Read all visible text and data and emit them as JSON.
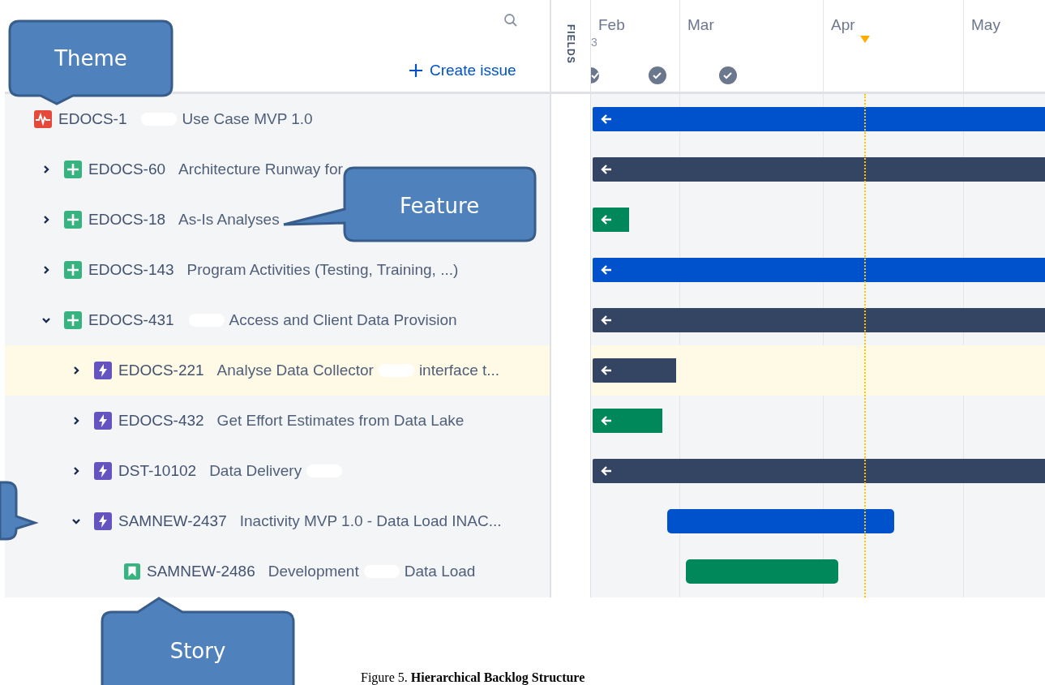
{
  "toolbar": {
    "create_button": "Create issue",
    "fields_label": "FIELDS"
  },
  "timeline": {
    "months": [
      "Feb",
      "Mar",
      "Apr",
      "May"
    ],
    "marker_count": "3"
  },
  "issues": [
    {
      "key": "EDOCS-1",
      "kind": "initiative",
      "selected": false,
      "parts": [
        {
          "kind": "redaction"
        },
        {
          "kind": "text",
          "text": "Use Case MVP 1.0"
        }
      ],
      "bar": {
        "color": "#0052cc",
        "continues_left": true
      },
      "children": [
        {
          "key": "EDOCS-60",
          "kind": "feature",
          "expanded": false,
          "selected": false,
          "parts": [
            {
              "kind": "text",
              "text": "Architecture Runway for"
            }
          ],
          "bar": {
            "color": "#344563",
            "continues_left": true
          }
        },
        {
          "key": "EDOCS-18",
          "kind": "feature",
          "expanded": false,
          "selected": false,
          "parts": [
            {
              "kind": "text",
              "text": "As-Is Analyses"
            }
          ],
          "bar": {
            "color": "#00875a",
            "continues_left": true
          }
        },
        {
          "key": "EDOCS-143",
          "kind": "feature",
          "expanded": false,
          "selected": false,
          "parts": [
            {
              "kind": "text",
              "text": "Program Activities (Testing, Training, ...)"
            }
          ],
          "bar": {
            "color": "#0052cc",
            "continues_left": true
          }
        },
        {
          "key": "EDOCS-431",
          "kind": "feature",
          "expanded": true,
          "selected": false,
          "parts": [
            {
              "kind": "redaction"
            },
            {
              "kind": "text",
              "text": "Access and Client Data Provision"
            }
          ],
          "bar": {
            "color": "#344563",
            "continues_left": true
          },
          "children": [
            {
              "key": "EDOCS-221",
              "kind": "epic",
              "expanded": false,
              "selected": true,
              "parts": [
                {
                  "kind": "text",
                  "text": "Analyse Data Collector"
                },
                {
                  "kind": "redaction"
                },
                {
                  "kind": "text",
                  "text": "interface t..."
                }
              ],
              "bar": {
                "color": "#344563",
                "continues_left": true
              }
            },
            {
              "key": "EDOCS-432",
              "kind": "epic",
              "expanded": false,
              "selected": false,
              "parts": [
                {
                  "kind": "text",
                  "text": "Get Effort Estimates from Data Lake"
                }
              ],
              "bar": {
                "color": "#00875a",
                "continues_left": true
              }
            },
            {
              "key": "DST-10102",
              "kind": "epic",
              "expanded": false,
              "selected": false,
              "parts": [
                {
                  "kind": "text",
                  "text": "Data Delivery"
                },
                {
                  "kind": "redaction"
                }
              ],
              "bar": {
                "color": "#344563",
                "continues_left": true
              }
            },
            {
              "key": "SAMNEW-2437",
              "kind": "epic",
              "expanded": true,
              "selected": false,
              "parts": [
                {
                  "kind": "text",
                  "text": "Inactivity MVP 1.0 - Data Load INAC..."
                }
              ],
              "bar": {
                "color": "#0052cc",
                "continues_left": false
              },
              "children": [
                {
                  "key": "SAMNEW-2486",
                  "kind": "story",
                  "selected": false,
                  "parts": [
                    {
                      "kind": "text",
                      "text": "Development"
                    },
                    {
                      "kind": "redaction"
                    },
                    {
                      "kind": "text",
                      "text": "Data Load"
                    }
                  ],
                  "bar": {
                    "color": "#00875a",
                    "continues_left": false
                  }
                }
              ]
            }
          ]
        }
      ]
    }
  ],
  "callouts": [
    {
      "label": "Theme"
    },
    {
      "label": "Feature"
    },
    {
      "label": "Story"
    }
  ],
  "caption": "Figure 5. **Hierarchical Backlog Structure**"
}
